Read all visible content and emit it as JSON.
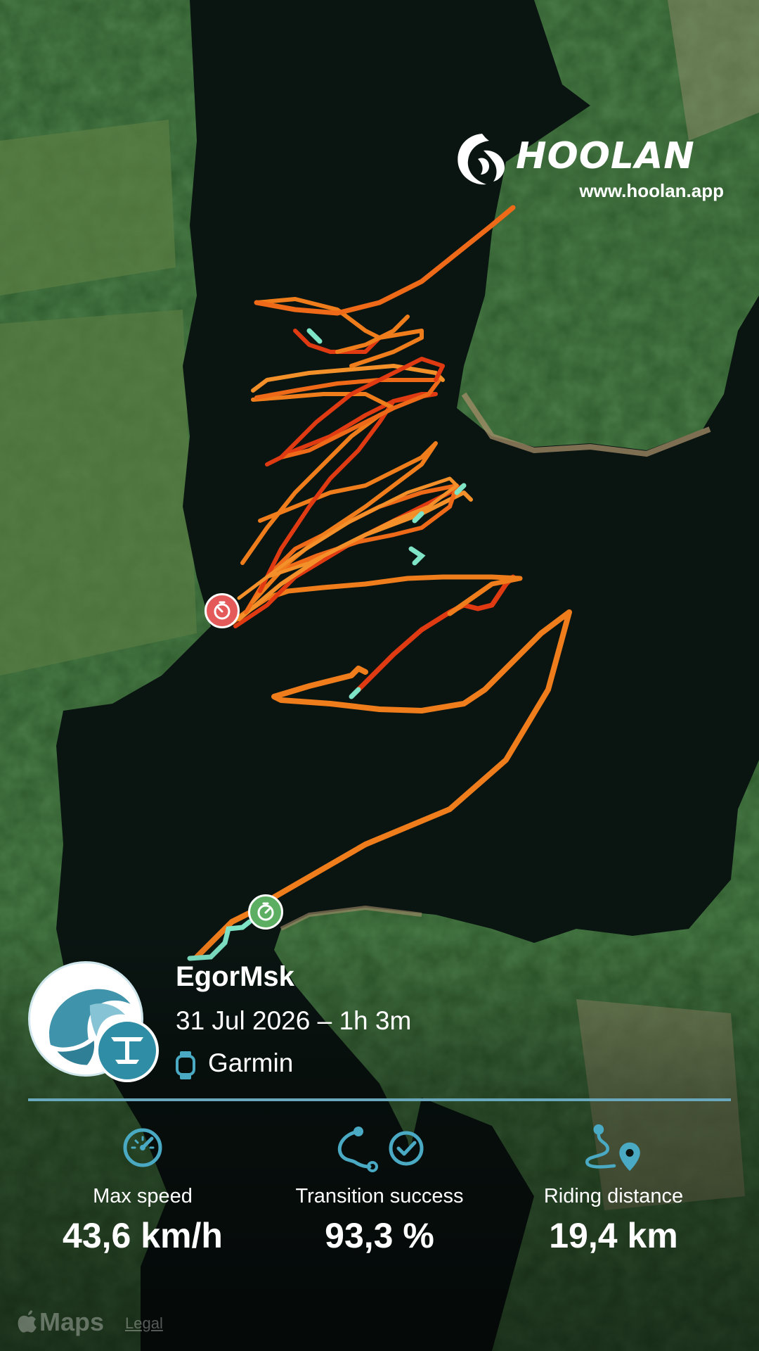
{
  "brand": {
    "name": "HOOLAN",
    "url": "www.hoolan.app"
  },
  "map": {
    "water_color": "#0a1512",
    "track_color_fast": "#e03a12",
    "track_color_mid": "#f07d1c",
    "track_color_slow": "#f3b13a",
    "transition_color": "#7fe3c6",
    "start_marker_color": "#5cae63",
    "end_marker_color": "#e45a5a"
  },
  "session": {
    "username": "EgorMsk",
    "date_duration": "31 Jul 2026 – 1h 3m",
    "device": "Garmin"
  },
  "stats": [
    {
      "icon": "speedometer-icon",
      "label": "Max speed",
      "value": "43,6 km/h"
    },
    {
      "icon": "transition-check-icon",
      "label": "Transition success",
      "value": "93,3 %"
    },
    {
      "icon": "route-pin-icon",
      "label": "Riding distance",
      "value": "19,4 km"
    }
  ],
  "attribution": {
    "maps": "Maps",
    "legal": "Legal"
  },
  "accent_color": "#4aa9c3"
}
